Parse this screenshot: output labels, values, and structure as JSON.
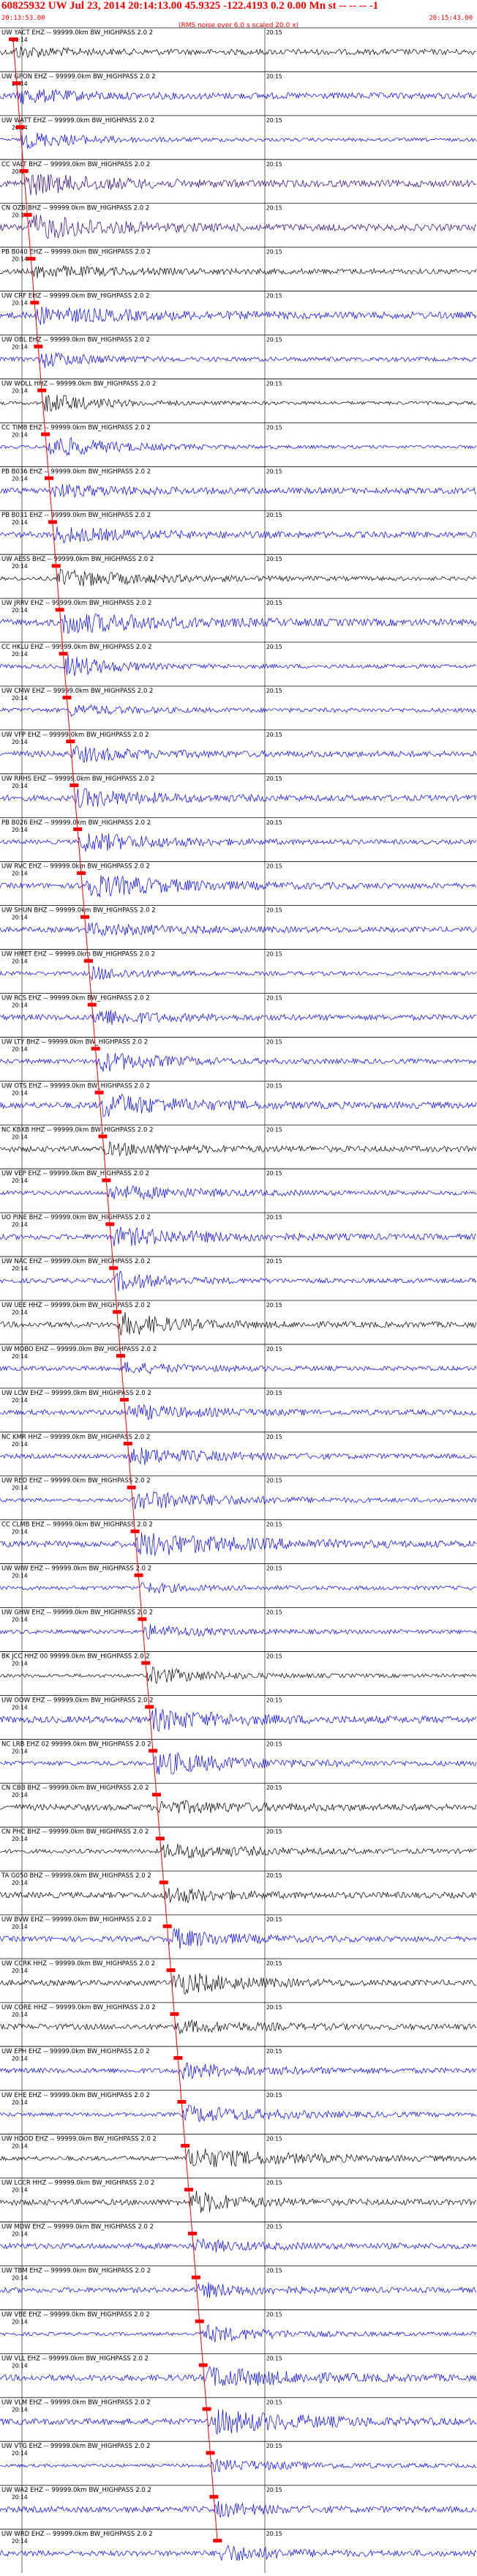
{
  "header": {
    "title": "60825932 UW Jul 23, 2014 20:14:13.00   45.9325 -122.4193  0.2 0.00 Mn st -- -- -- -1",
    "start_time": "20:13:53.00",
    "end_time": "20:15:43.00",
    "note": "(RMS noise over 6.0 s scaled 20.0 x)"
  },
  "chart_data": {
    "type": "line",
    "x_tick_labels": [
      "20:14",
      "20:15"
    ],
    "colors": {
      "trace_blue": "#0000ff",
      "trace_black": "#000000",
      "trace_indigo": "#2a007a",
      "pick": "#ff0000"
    },
    "channels": [
      {
        "label": "UW YACT EHZ -- 99999.0km BW_HIGHPASS  2.0  2",
        "color": "trace_black"
      },
      {
        "label": "UW GPON EHZ -- 99999.0km BW_HIGHPASS  2.0  2",
        "color": "trace_blue"
      },
      {
        "label": "UW WATT EHZ -- 99999.0km BW_HIGHPASS  2.0  2",
        "color": "trace_blue"
      },
      {
        "label": "CC VALT BHZ -- 99999.0km BW_HIGHPASS  2.0  2",
        "color": "trace_indigo"
      },
      {
        "label": "CN OZB BHZ -- 99999.0km BW_HIGHPASS  2.0  2",
        "color": "trace_indigo"
      },
      {
        "label": "PB B040 EHZ -- 99999.0km BW_HIGHPASS  2.0  2",
        "color": "trace_black"
      },
      {
        "label": "UW CRF EHZ -- 99999.0km BW_HIGHPASS  2.0  2",
        "color": "trace_blue"
      },
      {
        "label": "UW OBL EHZ -- 99999.0km BW_HIGHPASS  2.0  2",
        "color": "trace_blue"
      },
      {
        "label": "UW WOLL HHZ -- 99999.0km BW_HIGHPASS  2.0  2",
        "color": "trace_black"
      },
      {
        "label": "CC TIMB EHZ -- 99999.0km BW_HIGHPASS  2.0  2",
        "color": "trace_blue"
      },
      {
        "label": "PB B036 EHZ -- 99999.0km BW_HIGHPASS  2.0  2",
        "color": "trace_blue"
      },
      {
        "label": "PB B031 EHZ -- 99999.0km BW_HIGHPASS  2.0  2",
        "color": "trace_blue"
      },
      {
        "label": "UW AESS BHZ -- 99999.0km BW_HIGHPASS  2.0  2",
        "color": "trace_black"
      },
      {
        "label": "UW JRRV EHZ -- 99999.0km BW_HIGHPASS  2.0  2",
        "color": "trace_blue"
      },
      {
        "label": "CC HKLU EHZ -- 99999.0km BW_HIGHPASS  2.0  2",
        "color": "trace_blue"
      },
      {
        "label": "UW CMW EHZ -- 99999.0km BW_HIGHPASS  2.0  2",
        "color": "trace_blue"
      },
      {
        "label": "UW VFP EHZ -- 99999.0km BW_HIGHPASS  2.0  2",
        "color": "trace_blue"
      },
      {
        "label": "UW RRHS EHZ -- 99999.0km BW_HIGHPASS  2.0  2",
        "color": "trace_blue"
      },
      {
        "label": "PB B026 EHZ -- 99999.0km BW_HIGHPASS  2.0  2",
        "color": "trace_blue"
      },
      {
        "label": "UW RVC EHZ -- 99999.0km BW_HIGHPASS  2.0  2",
        "color": "trace_blue"
      },
      {
        "label": "UW SHUN BHZ -- 99999.0km BW_HIGHPASS  2.0  2",
        "color": "trace_blue"
      },
      {
        "label": "UW HMET EHZ -- 99999.0km BW_HIGHPASS  2.0  2",
        "color": "trace_blue"
      },
      {
        "label": "UW RCS EHZ -- 99999.0km BW_HIGHPASS  2.0  2",
        "color": "trace_blue"
      },
      {
        "label": "UW LTY BHZ -- 99999.0km BW_HIGHPASS  2.0  2",
        "color": "trace_blue"
      },
      {
        "label": "UW OTS EHZ -- 99999.0km BW_HIGHPASS  2.0  2",
        "color": "trace_blue"
      },
      {
        "label": "NC KBXB HHZ -- 99999.0km BW_HIGHPASS  2.0  2",
        "color": "trace_black"
      },
      {
        "label": "UW VEP EHZ -- 99999.0km BW_HIGHPASS  2.0  2",
        "color": "trace_blue"
      },
      {
        "label": "UO PINE BHZ -- 99999.0km BW_HIGHPASS  2.0  2",
        "color": "trace_blue"
      },
      {
        "label": "UW NAC EHZ -- 99999.0km BW_HIGHPASS  2.0  2",
        "color": "trace_blue"
      },
      {
        "label": "UW UEE HHZ -- 99999.0km BW_HIGHPASS  2.0  2",
        "color": "trace_black"
      },
      {
        "label": "UW MOBO EHZ -- 99999.0km BW_HIGHPASS  2.0  2",
        "color": "trace_blue"
      },
      {
        "label": "UW LCW EHZ -- 99999.0km BW_HIGHPASS  2.0  2",
        "color": "trace_blue"
      },
      {
        "label": "NC KMR HHZ -- 99999.0km BW_HIGHPASS  2.0  2",
        "color": "trace_blue"
      },
      {
        "label": "UW RED EHZ -- 99999.0km BW_HIGHPASS  2.0  2",
        "color": "trace_blue"
      },
      {
        "label": "CC CLMB EHZ -- 99999.0km BW_HIGHPASS  2.0  2",
        "color": "trace_blue"
      },
      {
        "label": "UW WIW EHZ -- 99999.0km BW_HIGHPASS  2.0  2",
        "color": "trace_blue"
      },
      {
        "label": "UW GHW EHZ -- 99999.0km BW_HIGHPASS  2.0  2",
        "color": "trace_blue"
      },
      {
        "label": "BK JCC HHZ 00 99999.0km BW_HIGHPASS  2.0  2",
        "color": "trace_black"
      },
      {
        "label": "UW OOW EHZ -- 99999.0km BW_HIGHPASS  2.0  2",
        "color": "trace_blue"
      },
      {
        "label": "NC LRB EHZ 02 99999.0km BW_HIGHPASS  2.0  2",
        "color": "trace_blue"
      },
      {
        "label": "CN CBB BHZ -- 99999.0km BW_HIGHPASS  2.0  2",
        "color": "trace_black"
      },
      {
        "label": "CN PHC BHZ -- 99999.0km BW_HIGHPASS  2.0  2",
        "color": "trace_black"
      },
      {
        "label": "TA G050 BHZ -- 99999.0km BW_HIGHPASS  2.0  2",
        "color": "trace_black"
      },
      {
        "label": "UW BVW EHZ -- 99999.0km BW_HIGHPASS  2.0  2",
        "color": "trace_blue"
      },
      {
        "label": "UW CCRK HHZ -- 99999.0km BW_HIGHPASS  2.0  2",
        "color": "trace_black"
      },
      {
        "label": "UW CORE HHZ -- 99999.0km BW_HIGHPASS  2.0  2",
        "color": "trace_black"
      },
      {
        "label": "UW EPH EHZ -- 99999.0km BW_HIGHPASS  2.0  2",
        "color": "trace_blue"
      },
      {
        "label": "UW EHE EHZ -- 99999.0km BW_HIGHPASS  2.0  2",
        "color": "trace_blue"
      },
      {
        "label": "UW HDOD EHZ -- 99999.0km BW_HIGHPASS  2.0  2",
        "color": "trace_black"
      },
      {
        "label": "UW LCCR HHZ -- 99999.0km BW_HIGHPASS  2.0  2",
        "color": "trace_black"
      },
      {
        "label": "UW MDW EHZ -- 99999.0km BW_HIGHPASS  2.0  2",
        "color": "trace_blue"
      },
      {
        "label": "UW TBM EHZ -- 99999.0km BW_HIGHPASS  2.0  2",
        "color": "trace_blue"
      },
      {
        "label": "UW VBE EHZ -- 99999.0km BW_HIGHPASS  2.0  2",
        "color": "trace_blue"
      },
      {
        "label": "UW VLL EHZ -- 99999.0km BW_HIGHPASS  2.0  2",
        "color": "trace_blue"
      },
      {
        "label": "UW VLM EHZ -- 99999.0km BW_HIGHPASS  2.0  2",
        "color": "trace_blue"
      },
      {
        "label": "UW VTG EHZ -- 99999.0km BW_HIGHPASS  2.0  2",
        "color": "trace_blue"
      },
      {
        "label": "UW WA2 EHZ -- 99999.0km BW_HIGHPASS  2.0  2",
        "color": "trace_blue"
      },
      {
        "label": "UW WRD EHZ -- 99999.0km BW_HIGHPASS  2.0  2",
        "color": "trace_blue"
      }
    ]
  }
}
